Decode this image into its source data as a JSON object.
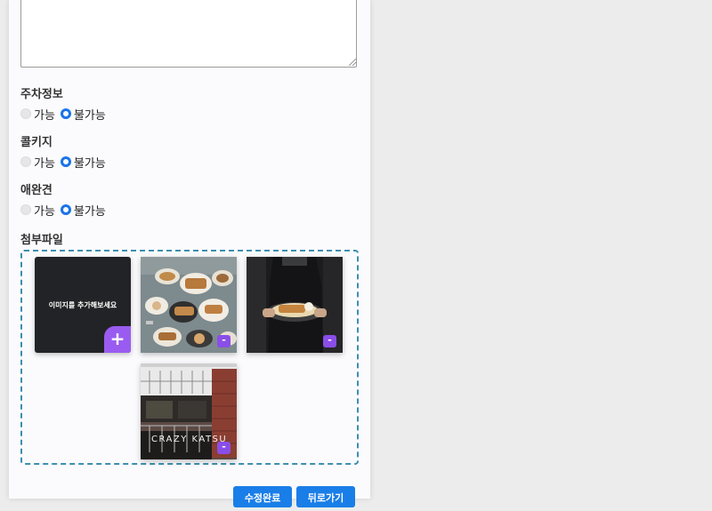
{
  "form": {
    "parking": {
      "label": "주차정보",
      "opt_yes": "가능",
      "opt_no": "불가능",
      "selected": "불가능"
    },
    "corkage": {
      "label": "콜키지",
      "opt_yes": "가능",
      "opt_no": "불가능",
      "selected": "불가능"
    },
    "pets": {
      "label": "애완견",
      "opt_yes": "가능",
      "opt_no": "불가능",
      "selected": "불가능"
    },
    "attachments": {
      "label": "첨부파일",
      "add_text": "이미지를 추가해보세요",
      "add_symbol": "+",
      "remove_symbol": "-",
      "sign_text": "CRAZY KATSU"
    }
  },
  "buttons": {
    "submit": "수정완료",
    "back": "뒤로가기"
  },
  "colors": {
    "accent": "#1a7ee8",
    "purple": "#9a5cf0",
    "dropzone_border": "#3d8fb0"
  }
}
